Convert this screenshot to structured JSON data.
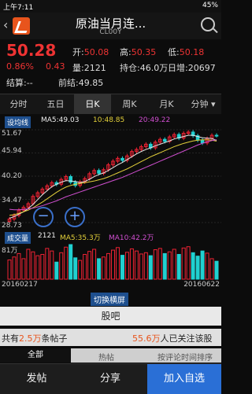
{
  "status": {
    "time": "上午7:11",
    "battery": "45%"
  },
  "header": {
    "back_icon": "back-icon",
    "title": "原油当月连...",
    "subtitle": "CL00Y"
  },
  "quote": {
    "last": "50.28",
    "change_pct": "0.86%",
    "change": "0.43",
    "open_label": "开:",
    "open": "50.08",
    "high_label": "高:",
    "high": "50.35",
    "low_label": "低:",
    "low": "50.18",
    "volume_label": "量:",
    "volume": "2121",
    "hold_label": "持仓:",
    "hold": "46.0万",
    "daily_add_label": "日增:",
    "daily_add": "20697",
    "settle_label": "结算:",
    "settle": "--",
    "prev_settle_label": "前结:",
    "prev_settle": "49.85"
  },
  "tabs": [
    "分时",
    "五日",
    "日K",
    "周K",
    "月K",
    "分钟"
  ],
  "indicator_price": {
    "badge": "设均线",
    "ma5_label": "MA5:49.03",
    "ma10_label": "10:48.85",
    "ma20_label": "20:49.22"
  },
  "price_axis": [
    "51.67",
    "45.94",
    "40.20",
    "34.47",
    "28.73"
  ],
  "volume_panel": {
    "badge": "成交量",
    "value": "2121",
    "ma5": "MA5:35.3万",
    "ma10": "MA10:42.2万",
    "top_label": "81万"
  },
  "dates": {
    "start": "20160217",
    "end": "20160622"
  },
  "toggle_label": "切换横屏",
  "guba_label": "股吧",
  "stats": {
    "posts_prefix": "共有",
    "posts_count": "2.5万",
    "posts_suffix": "条帖子",
    "followers_count": "55.6万",
    "followers_suffix": "人已关注该股"
  },
  "filter": {
    "all": "全部",
    "hot": "热帖",
    "sort": "按评论时间排序"
  },
  "bottom": {
    "post": "发帖",
    "share": "分享",
    "add": "加入自选"
  },
  "chart_data": {
    "type": "line",
    "title": "",
    "ylim": [
      28.73,
      51.67
    ],
    "series": [
      {
        "name": "close",
        "values": [
          29.6,
          30.5,
          31.8,
          32.5,
          33.4,
          35.2,
          36.1,
          37.0,
          37.8,
          38.6,
          38.2,
          39.4,
          40.1,
          38.7,
          37.9,
          38.8,
          39.6,
          40.8,
          41.6,
          40.9,
          41.8,
          43.0,
          43.9,
          44.6,
          44.1,
          45.2,
          46.3,
          46.8,
          47.5,
          48.1,
          47.2,
          48.6,
          49.3,
          48.8,
          49.9,
          50.5,
          49.6,
          50.8,
          51.1,
          50.2,
          49.1,
          48.4,
          49.5,
          50.3,
          50.28
        ]
      },
      {
        "name": "MA5",
        "values": [
          29.8,
          30.2,
          30.8,
          31.4,
          32.2,
          33.2,
          34.4,
          35.6,
          36.6,
          37.6,
          38.2,
          38.7,
          39.1,
          39.0,
          38.9,
          38.6,
          38.9,
          39.4,
          40.1,
          40.6,
          41.0,
          41.6,
          42.3,
          43.0,
          43.6,
          44.3,
          45.0,
          45.7,
          46.3,
          46.8,
          47.2,
          47.7,
          48.1,
          48.5,
          48.9,
          49.4,
          49.7,
          50.0,
          50.3,
          50.3,
          50.0,
          49.7,
          49.6,
          49.5,
          49.03
        ]
      },
      {
        "name": "MA10",
        "values": [
          30.5,
          30.7,
          31.0,
          31.4,
          31.8,
          32.4,
          33.1,
          33.8,
          34.6,
          35.4,
          36.2,
          36.9,
          37.5,
          37.9,
          38.2,
          38.4,
          38.6,
          38.8,
          39.0,
          39.3,
          39.6,
          40.0,
          40.5,
          41.0,
          41.5,
          42.0,
          42.6,
          43.2,
          43.8,
          44.4,
          45.0,
          45.5,
          46.0,
          46.5,
          47.0,
          47.5,
          47.9,
          48.3,
          48.6,
          48.9,
          49.1,
          49.2,
          49.2,
          49.1,
          48.85
        ]
      },
      {
        "name": "MA20",
        "values": [
          32.0,
          31.9,
          31.9,
          32.0,
          32.1,
          32.3,
          32.6,
          32.9,
          33.3,
          33.7,
          34.1,
          34.6,
          35.1,
          35.5,
          35.9,
          36.3,
          36.7,
          37.1,
          37.5,
          37.9,
          38.3,
          38.7,
          39.1,
          39.5,
          39.9,
          40.4,
          40.9,
          41.4,
          41.9,
          42.4,
          42.9,
          43.4,
          43.9,
          44.4,
          44.9,
          45.4,
          45.9,
          46.4,
          46.9,
          47.4,
          47.9,
          48.3,
          48.7,
          49.0,
          49.22
        ]
      }
    ],
    "volume": [
      45,
      52,
      60,
      48,
      70,
      64,
      55,
      58,
      72,
      66,
      40,
      62,
      75,
      81,
      50,
      44,
      58,
      65,
      70,
      48,
      52,
      60,
      68,
      74,
      56,
      63,
      71,
      66,
      59,
      62,
      55,
      69,
      72,
      60,
      64,
      70,
      58,
      73,
      76,
      62,
      54,
      66,
      61,
      48,
      42
    ]
  }
}
